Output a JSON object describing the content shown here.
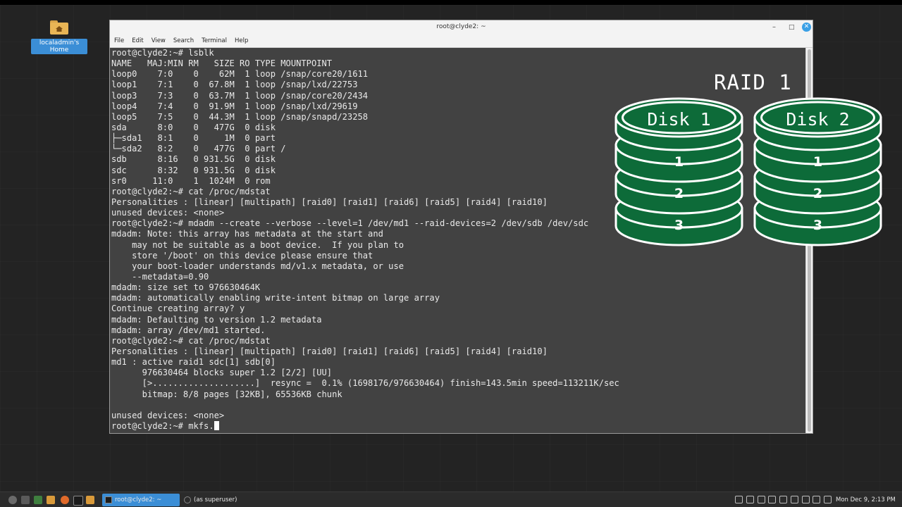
{
  "desktop": {
    "home_icon_label": "localadmin's Home"
  },
  "window": {
    "title": "root@clyde2: ~",
    "menu": [
      "File",
      "Edit",
      "View",
      "Search",
      "Terminal",
      "Help"
    ]
  },
  "terminal": {
    "lines": [
      "root@clyde2:~# lsblk",
      "NAME   MAJ:MIN RM   SIZE RO TYPE MOUNTPOINT",
      "loop0    7:0    0    62M  1 loop /snap/core20/1611",
      "loop1    7:1    0  67.8M  1 loop /snap/lxd/22753",
      "loop3    7:3    0  63.7M  1 loop /snap/core20/2434",
      "loop4    7:4    0  91.9M  1 loop /snap/lxd/29619",
      "loop5    7:5    0  44.3M  1 loop /snap/snapd/23258",
      "sda      8:0    0   477G  0 disk",
      "├─sda1   8:1    0     1M  0 part",
      "└─sda2   8:2    0   477G  0 part /",
      "sdb      8:16   0 931.5G  0 disk",
      "sdc      8:32   0 931.5G  0 disk",
      "sr0     11:0    1  1024M  0 rom",
      "root@clyde2:~# cat /proc/mdstat",
      "Personalities : [linear] [multipath] [raid0] [raid1] [raid6] [raid5] [raid4] [raid10]",
      "unused devices: <none>",
      "root@clyde2:~# mdadm --create --verbose --level=1 /dev/md1 --raid-devices=2 /dev/sdb /dev/sdc",
      "mdadm: Note: this array has metadata at the start and",
      "    may not be suitable as a boot device.  If you plan to",
      "    store '/boot' on this device please ensure that",
      "    your boot-loader understands md/v1.x metadata, or use",
      "    --metadata=0.90",
      "mdadm: size set to 976630464K",
      "mdadm: automatically enabling write-intent bitmap on large array",
      "Continue creating array? y",
      "mdadm: Defaulting to version 1.2 metadata",
      "mdadm: array /dev/md1 started.",
      "root@clyde2:~# cat /proc/mdstat",
      "Personalities : [linear] [multipath] [raid0] [raid1] [raid6] [raid5] [raid4] [raid10]",
      "md1 : active raid1 sdc[1] sdb[0]",
      "      976630464 blocks super 1.2 [2/2] [UU]",
      "      [>....................]  resync =  0.1% (1698176/976630464) finish=143.5min speed=113211K/sec",
      "      bitmap: 8/8 pages [32KB], 65536KB chunk",
      "",
      "unused devices: <none>"
    ],
    "prompt": "root@clyde2:~# mkfs."
  },
  "overlay": {
    "title": "RAID 1",
    "disks": [
      {
        "label": "Disk 1",
        "partitions": [
          "1",
          "2",
          "3"
        ]
      },
      {
        "label": "Disk 2",
        "partitions": [
          "1",
          "2",
          "3"
        ]
      }
    ],
    "disk_color": "#0d6b39"
  },
  "taskbar": {
    "tasks": [
      "root@clyde2: ~",
      "(as superuser)"
    ],
    "clock": "Mon Dec 9, 2:13 PM"
  }
}
